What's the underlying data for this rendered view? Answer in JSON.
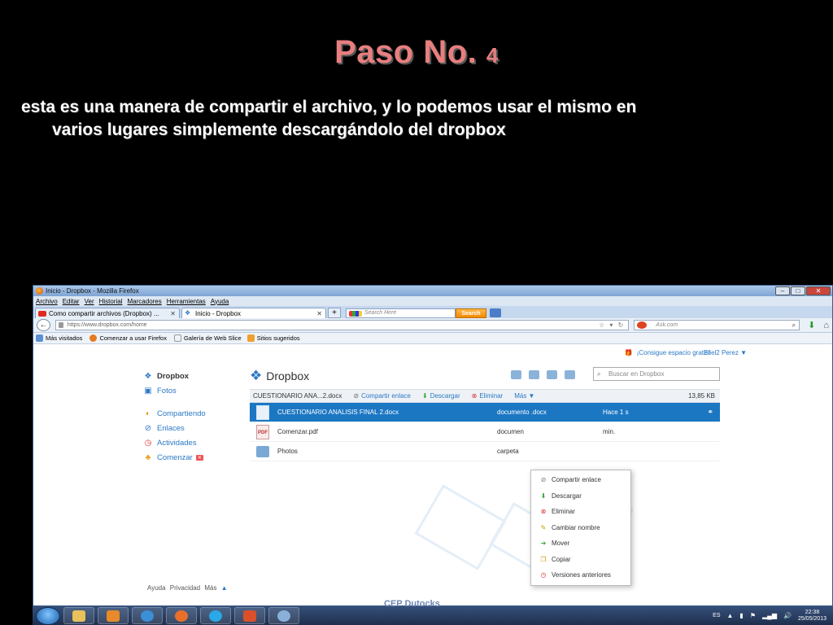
{
  "slide": {
    "title_main": "Paso No.",
    "title_num": "4",
    "body_line1": "esta es una manera de compartir el archivo, y lo podemos usar el mismo en",
    "body_line2": "varios lugares simplemente descargándolo del dropbox"
  },
  "browser": {
    "window_title": "Inicio - Dropbox - Mozilla Firefox",
    "menu": [
      "Archivo",
      "Editar",
      "Ver",
      "Historial",
      "Marcadores",
      "Herramientas",
      "Ayuda"
    ],
    "tabs": [
      {
        "label": "Como compartir archivos (Dropbox) ..."
      },
      {
        "label": "Inicio - Dropbox"
      }
    ],
    "new_tab": "+",
    "ask_search_placeholder": "Search Here",
    "ask_search_button": "Search",
    "url": "https://www.dropbox.com/home",
    "ask_bar_placeholder": "Ask.com",
    "bookmarks": [
      "Más visitados",
      "Comenzar a usar Firefox",
      "Galería de Web Slice",
      "Sitios sugeridos"
    ]
  },
  "dropbox": {
    "promo": "¡Consigue espacio gratis!",
    "user": "Eliel2 Perez ▼",
    "sidebar": {
      "brand": "Dropbox",
      "items": [
        "Fotos",
        "Compartiendo",
        "Enlaces",
        "Actividades",
        "Comenzar"
      ]
    },
    "header_title": "Dropbox",
    "search_placeholder": "Buscar en Dropbox",
    "actionbar": {
      "filename": "CUESTIONARIO ANA...2.docx",
      "share": "Compartir enlace",
      "download": "Descargar",
      "delete": "Eliminar",
      "more": "Más ▼",
      "size": "13,85 KB"
    },
    "files": [
      {
        "name": "CUESTIONARIO ANALISIS FINAL 2.docx",
        "kind": "documento .docx",
        "modified": "Hace 1 s"
      },
      {
        "name": "Comenzar.pdf",
        "kind": "documen",
        "modified": "min."
      },
      {
        "name": "Photos",
        "kind": "carpeta",
        "modified": ""
      }
    ],
    "context_menu": [
      "Compartir enlace",
      "Descargar",
      "Eliminar",
      "Cambiar nombre",
      "Mover",
      "Copiar",
      "Versiones anteriores"
    ],
    "footer": [
      "Ayuda",
      "Privacidad",
      "Más",
      "▲"
    ]
  },
  "taskbar": {
    "overlay_text": "CEP Dutocks",
    "lang": "ES",
    "time": "22:38",
    "date": "25/05/2013"
  }
}
